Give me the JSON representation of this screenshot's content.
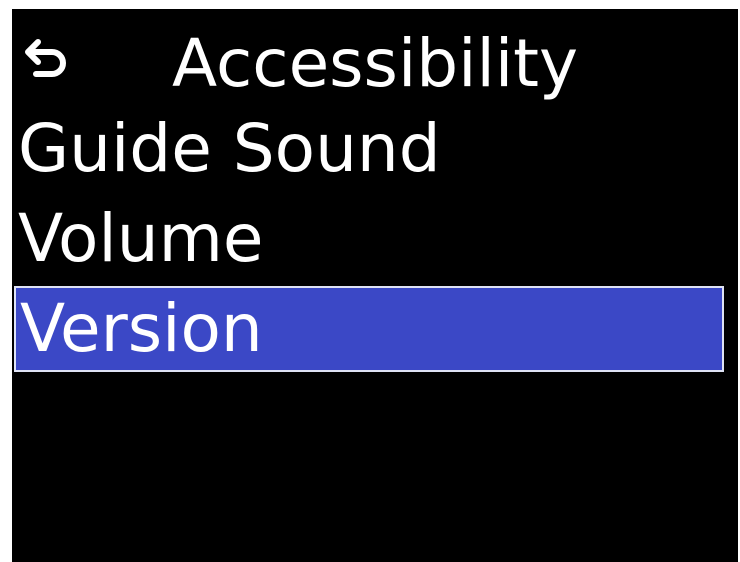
{
  "header": {
    "back_icon": "return-arrow-icon",
    "title": "Accessibility"
  },
  "menu": {
    "items": [
      {
        "label": "Guide Sound",
        "selected": false
      },
      {
        "label": "Volume",
        "selected": false
      },
      {
        "label": "Version",
        "selected": true
      }
    ]
  },
  "colors": {
    "background": "#000000",
    "text": "#ffffff",
    "selection": "#3b48c6",
    "selection_border": "#dfe3f5"
  }
}
